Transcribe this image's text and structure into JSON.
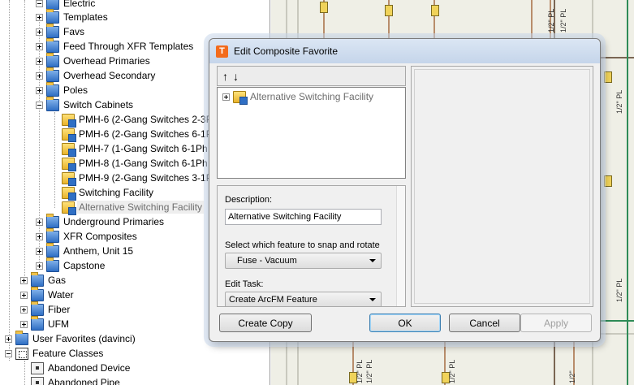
{
  "tree": {
    "electric": "Electric",
    "electric_children": [
      "Templates",
      "Favs",
      "Feed Through XFR Templates",
      "Overhead Primaries",
      "Overhead Secondary",
      "Poles",
      "Switch Cabinets"
    ],
    "switch_cabinet_items": [
      "PMH-6 (2-Gang Switches  2-3Ph",
      "PMH-6 (2-Gang Switches  6-1Ph",
      "PMH-7 (1-Gang Switch  6-1Ph",
      "PMH-8 (1-Gang Switch  6-1Ph",
      "PMH-9 (2-Gang Switches  3-1Ph",
      "Switching Facility",
      "Alternative Switching Facility"
    ],
    "electric_after": [
      "Underground Primaries",
      "XFR Composites",
      "Anthem, Unit 15",
      "Capstone"
    ],
    "top_level": [
      "Gas",
      "Water",
      "Fiber",
      "UFM"
    ],
    "user_favorites": "User Favorites (davinci)",
    "feature_classes": "Feature Classes",
    "feature_class_items": [
      "Abandoned Device",
      "Abandoned Pipe"
    ]
  },
  "map": {
    "labels": [
      "1/2\" PL",
      "1/2\" PL",
      "1/2\" PL",
      "1/2\" PL",
      "1/2\"",
      "1/2\" PL",
      "1/2\" PL",
      "1/2\" PL"
    ]
  },
  "dialog": {
    "title": "Edit Composite Favorite",
    "app_icon": "T",
    "up_arrow": "↑",
    "down_arrow": "↓",
    "composite_item": "Alternative Switching Facility",
    "description_label": "Description:",
    "description_value": "Alternative Switching Facility",
    "snap_label": "Select which feature to snap and rotate",
    "snap_value": "Fuse - Vacuum",
    "edit_task_label": "Edit Task:",
    "edit_task_value": "Create ArcFM Feature",
    "buttons": {
      "create_copy": "Create Copy",
      "ok": "OK",
      "cancel": "Cancel",
      "apply": "Apply"
    }
  },
  "colors": {
    "selection_text": "#6d6d6d",
    "map_background": "#efefe6",
    "app_icon": "#f36b1c"
  }
}
